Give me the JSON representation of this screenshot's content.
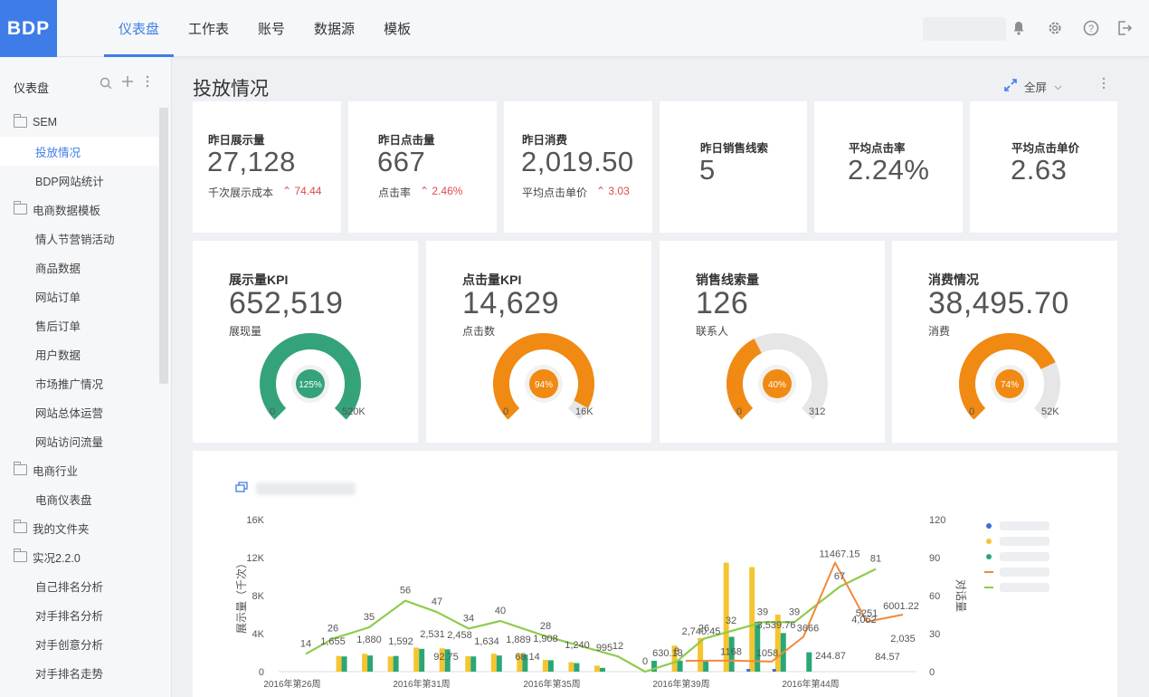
{
  "app": {
    "logo": "BDP",
    "nav": [
      "仪表盘",
      "工作表",
      "账号",
      "数据源",
      "模板"
    ],
    "active_nav": 0
  },
  "sidebar": {
    "title": "仪表盘",
    "items": [
      {
        "label": "SEM",
        "type": "folder"
      },
      {
        "label": "投放情况",
        "type": "child",
        "active": true
      },
      {
        "label": "BDP网站统计",
        "type": "child"
      },
      {
        "label": "电商数据模板",
        "type": "folder"
      },
      {
        "label": "情人节营销活动",
        "type": "child"
      },
      {
        "label": "商品数据",
        "type": "child"
      },
      {
        "label": "网站订单",
        "type": "child"
      },
      {
        "label": "售后订单",
        "type": "child"
      },
      {
        "label": "用户数据",
        "type": "child"
      },
      {
        "label": "市场推广情况",
        "type": "child"
      },
      {
        "label": "网站总体运营",
        "type": "child"
      },
      {
        "label": "网站访问流量",
        "type": "child"
      },
      {
        "label": "电商行业",
        "type": "folder"
      },
      {
        "label": "电商仪表盘",
        "type": "child"
      },
      {
        "label": "我的文件夹",
        "type": "folder"
      },
      {
        "label": "实况2.2.0",
        "type": "folder"
      },
      {
        "label": "自己排名分析",
        "type": "child"
      },
      {
        "label": "对手排名分析",
        "type": "child"
      },
      {
        "label": "对手创意分析",
        "type": "child"
      },
      {
        "label": "对手排名走势",
        "type": "child"
      }
    ]
  },
  "page": {
    "title": "投放情况",
    "fullscreen_label": "全屏"
  },
  "stats": [
    {
      "label": "昨日展示量",
      "value": "27,128",
      "sub_label": "千次展示成本",
      "sub_value": "74.44"
    },
    {
      "label": "昨日点击量",
      "value": "667",
      "sub_label": "点击率",
      "sub_value": "2.46%"
    },
    {
      "label": "昨日消费",
      "value": "2,019.50",
      "sub_label": "平均点击单价",
      "sub_value": "3.03"
    },
    {
      "label": "昨日销售线索",
      "value": "5"
    },
    {
      "label": "平均点击率",
      "value": "2.24%"
    },
    {
      "label": "平均点击单价",
      "value": "2.63"
    }
  ],
  "kpis": [
    {
      "title": "展示量KPI",
      "value": "652,519",
      "sub": "展现量",
      "percent_label": "125%",
      "fill": 1.0,
      "min": "0",
      "max": "520K",
      "color": "#35a37a"
    },
    {
      "title": "点击量KPI",
      "value": "14,629",
      "sub": "点击数",
      "percent_label": "94%",
      "fill": 0.94,
      "min": "0",
      "max": "16K",
      "color": "#f08a12"
    },
    {
      "title": "销售线索量",
      "value": "126",
      "sub": "联系人",
      "percent_label": "40%",
      "fill": 0.4,
      "min": "0",
      "max": "312",
      "color": "#f08a12"
    },
    {
      "title": "消费情况",
      "value": "38,495.70",
      "sub": "消费",
      "percent_label": "74%",
      "fill": 0.74,
      "min": "0",
      "max": "52K",
      "color": "#f08a12"
    }
  ],
  "chart_data": {
    "type": "bar",
    "left_axis": {
      "label": "展示量（千次）",
      "ticks": [
        "0",
        "4K",
        "8K",
        "12K",
        "16K"
      ],
      "ylim": [
        0,
        16000
      ]
    },
    "right_axis": {
      "label": "对话量",
      "ticks": [
        "0",
        "30",
        "60",
        "90",
        "120"
      ],
      "ylim": [
        0,
        120
      ]
    },
    "x_ticks": [
      "2016年第26周",
      "2016年第31周",
      "2016年第35周",
      "2016年第39周",
      "2016年第44周"
    ],
    "colors": {
      "blue": "#3b6fd8",
      "yellow": "#f5c531",
      "green": "#2aa776",
      "orange": "#f08a3c",
      "lightgreen": "#8fcc4a"
    },
    "line_lightgreen_values": [
      14,
      26,
      35,
      56,
      47,
      34,
      40,
      28,
      12,
      0,
      8,
      26,
      32,
      39,
      39,
      67,
      81
    ],
    "line_orange_values": [
      1142,
      1168,
      1058,
      3666,
      11467.15,
      5251,
      6001.22
    ],
    "bar_labels": [
      "1,655",
      "1,880",
      "1,592",
      "2,531",
      "2,458",
      "92.75",
      "1,634",
      "1,889",
      "1,908",
      "68.14",
      "1,240",
      "995",
      "630.13",
      "2,740.45",
      "3,539.76",
      "244.87",
      "4,062",
      "2,035",
      "84.57"
    ],
    "yellow_bars": [
      1655,
      1880,
      1592,
      2531,
      2458,
      1634,
      1889,
      1908,
      1240,
      995,
      630,
      2740,
      3540,
      11467,
      11000,
      6001
    ],
    "green_bars": [
      1600,
      1700,
      1650,
      2400,
      2350,
      1600,
      1700,
      1800,
      1200,
      900,
      400,
      1142,
      1168,
      1058,
      3666,
      5251,
      4062,
      2035
    ],
    "legend": [
      "",
      "",
      "",
      "",
      ""
    ]
  }
}
